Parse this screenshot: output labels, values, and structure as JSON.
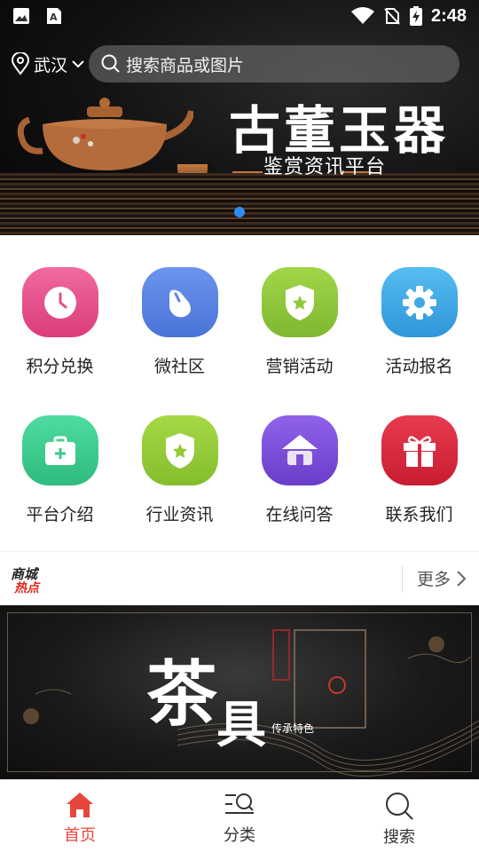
{
  "status_bar": {
    "time": "2:48",
    "icons": [
      "image-icon",
      "a-letter-icon",
      "wifi-icon",
      "no-sim-icon",
      "battery-charging-icon"
    ]
  },
  "top": {
    "city": "武汉",
    "search_placeholder": "搜索商品或图片"
  },
  "banner": {
    "title": "古董玉器",
    "subtitle": "鉴赏资讯平台",
    "active_dot_color": "#2f8cf3"
  },
  "grid": {
    "items": [
      {
        "label": "积分兑换",
        "icon": "clock-icon",
        "color": "#e64c8b"
      },
      {
        "label": "微社区",
        "icon": "mouse-icon",
        "color": "#5a84e5"
      },
      {
        "label": "营销活动",
        "icon": "shield-star-icon",
        "color": "#8fc93d"
      },
      {
        "label": "活动报名",
        "icon": "gear-icon",
        "color": "#3fa8e6"
      },
      {
        "label": "平台介绍",
        "icon": "medkit-icon",
        "color": "#3ac98c"
      },
      {
        "label": "行业资讯",
        "icon": "shield-star-icon",
        "color": "#93ca33"
      },
      {
        "label": "在线问答",
        "icon": "house-icon",
        "color": "#7d4fd8"
      },
      {
        "label": "联系我们",
        "icon": "gift-icon",
        "color": "#d9283d"
      }
    ]
  },
  "hot": {
    "logo_line1": "商城",
    "logo_line2": "热点",
    "more_label": "更多"
  },
  "tea_banner": {
    "char1": "茶",
    "char2": "具",
    "caption": "传承特色"
  },
  "bottom_nav": {
    "items": [
      {
        "label": "首页",
        "icon": "home-icon",
        "active": true
      },
      {
        "label": "分类",
        "icon": "category-search-icon",
        "active": false
      },
      {
        "label": "搜索",
        "icon": "search-icon",
        "active": false
      }
    ],
    "active_color": "#e8453c"
  }
}
